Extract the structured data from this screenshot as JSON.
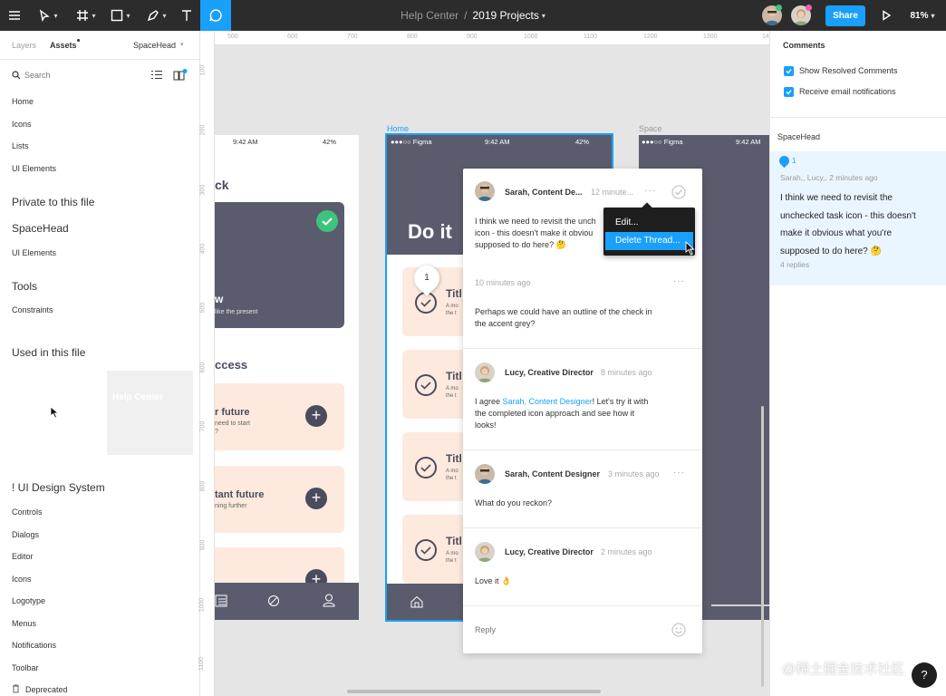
{
  "topbar": {
    "breadcrumb_team": "Help Center",
    "breadcrumb_sep": "/",
    "breadcrumb_project": "2019 Projects",
    "share_label": "Share",
    "zoom": "81%"
  },
  "left_panel": {
    "tabs": [
      "Layers",
      "Assets"
    ],
    "library": "SpaceHead",
    "search_placeholder": "Search",
    "items_top": [
      "Home",
      "Icons",
      "Lists",
      "UI Elements"
    ],
    "section_private": "Private to this file",
    "section_spacehead": "SpaceHead",
    "spacehead_items": [
      "UI Elements"
    ],
    "section_tools": "Tools",
    "tools_items": [
      "Constraints"
    ],
    "section_used": "Used in this file",
    "used_thumb": "Help Center",
    "section_uds": "! UI Design System",
    "uds_items": [
      "Controls",
      "Dialogs",
      "Editor",
      "Icons",
      "Logotype",
      "Menus",
      "Notifications",
      "Toolbar",
      "Deprecated"
    ]
  },
  "ruler": {
    "h": [
      "500",
      "600",
      "700",
      "800",
      "900",
      "1000",
      "1100",
      "1200",
      "1300",
      "14"
    ],
    "v": [
      "100",
      "200",
      "300",
      "400",
      "500",
      "600",
      "700",
      "800",
      "900",
      "1000",
      "1100"
    ]
  },
  "canvas": {
    "frame1": {
      "time": "9:42 AM",
      "battery": "42%",
      "heading": "ck",
      "card_w": "w",
      "card_sub": "like the present",
      "section": "ccess",
      "rows": [
        {
          "title": "r future",
          "sub": "need to start",
          "sub2": "?"
        },
        {
          "title": "tant future",
          "sub": "ning further",
          "sub2": ""
        }
      ]
    },
    "frame2_label": "Home",
    "frame2": {
      "carrier": "●●●○○ Figma",
      "time": "9:42 AM",
      "battery": "42%",
      "heading": "Do it",
      "items": [
        {
          "title": "Titl",
          "sub1": "A mo",
          "sub2": "the t"
        },
        {
          "title": "Titl",
          "sub1": "A mo",
          "sub2": "the t"
        },
        {
          "title": "Titl",
          "sub1": "A mo",
          "sub2": "the t"
        },
        {
          "title": "Titl",
          "sub1": "A mo",
          "sub2": "the t"
        }
      ],
      "pin": "1"
    },
    "frame3_label": "Space",
    "frame3": {
      "carrier": "●●●○○ Figma",
      "time": "9:42 AM"
    }
  },
  "thread": {
    "comments": [
      {
        "author": "Sarah, Content De...",
        "time": "12 minute...",
        "text": [
          "I think we need to revisit the unch",
          "icon - this doesn't make it obviou",
          "supposed to do here? 🤔"
        ]
      },
      {
        "author": "",
        "time": "10 minutes ago",
        "text": [
          "Perhaps we could have an outline of the check in",
          "the accent grey?"
        ]
      },
      {
        "author": "Lucy, Creative Director",
        "time": "8 minutes ago",
        "text_pre": "I agree ",
        "mention": "Sarah, Content Designer",
        "text_post": "! Let's try it with",
        "text2": [
          "the completed icon approach and see how it",
          "looks!"
        ]
      },
      {
        "author": "Sarah, Content Designer",
        "time": "3 minutes ago",
        "text": [
          "What do you reckon?"
        ]
      },
      {
        "author": "Lucy, Creative Director",
        "time": "2 minutes ago",
        "text": [
          "Love it 👌"
        ]
      }
    ],
    "reply_placeholder": "Reply",
    "menu": [
      "Edit...",
      "Delete Thread..."
    ]
  },
  "right_panel": {
    "title": "Comments",
    "opt1": "Show Resolved Comments",
    "opt2": "Receive email notifications",
    "group": "SpaceHead",
    "pin_num": "1",
    "meta": "Sarah,, Lucy,, 2 minutes ago",
    "text": [
      "I think we need to revisit the",
      "unchecked task icon - this doesn't",
      "make it obvious what you're",
      "supposed to do here? 🤔"
    ],
    "replies": "4 replies"
  },
  "watermark": "@稀土掘金技术社区",
  "colors": {
    "accent": "#18a0fb",
    "dark": "#4a4c5e",
    "peach": "#fde9dd",
    "green": "#3cc47c"
  }
}
